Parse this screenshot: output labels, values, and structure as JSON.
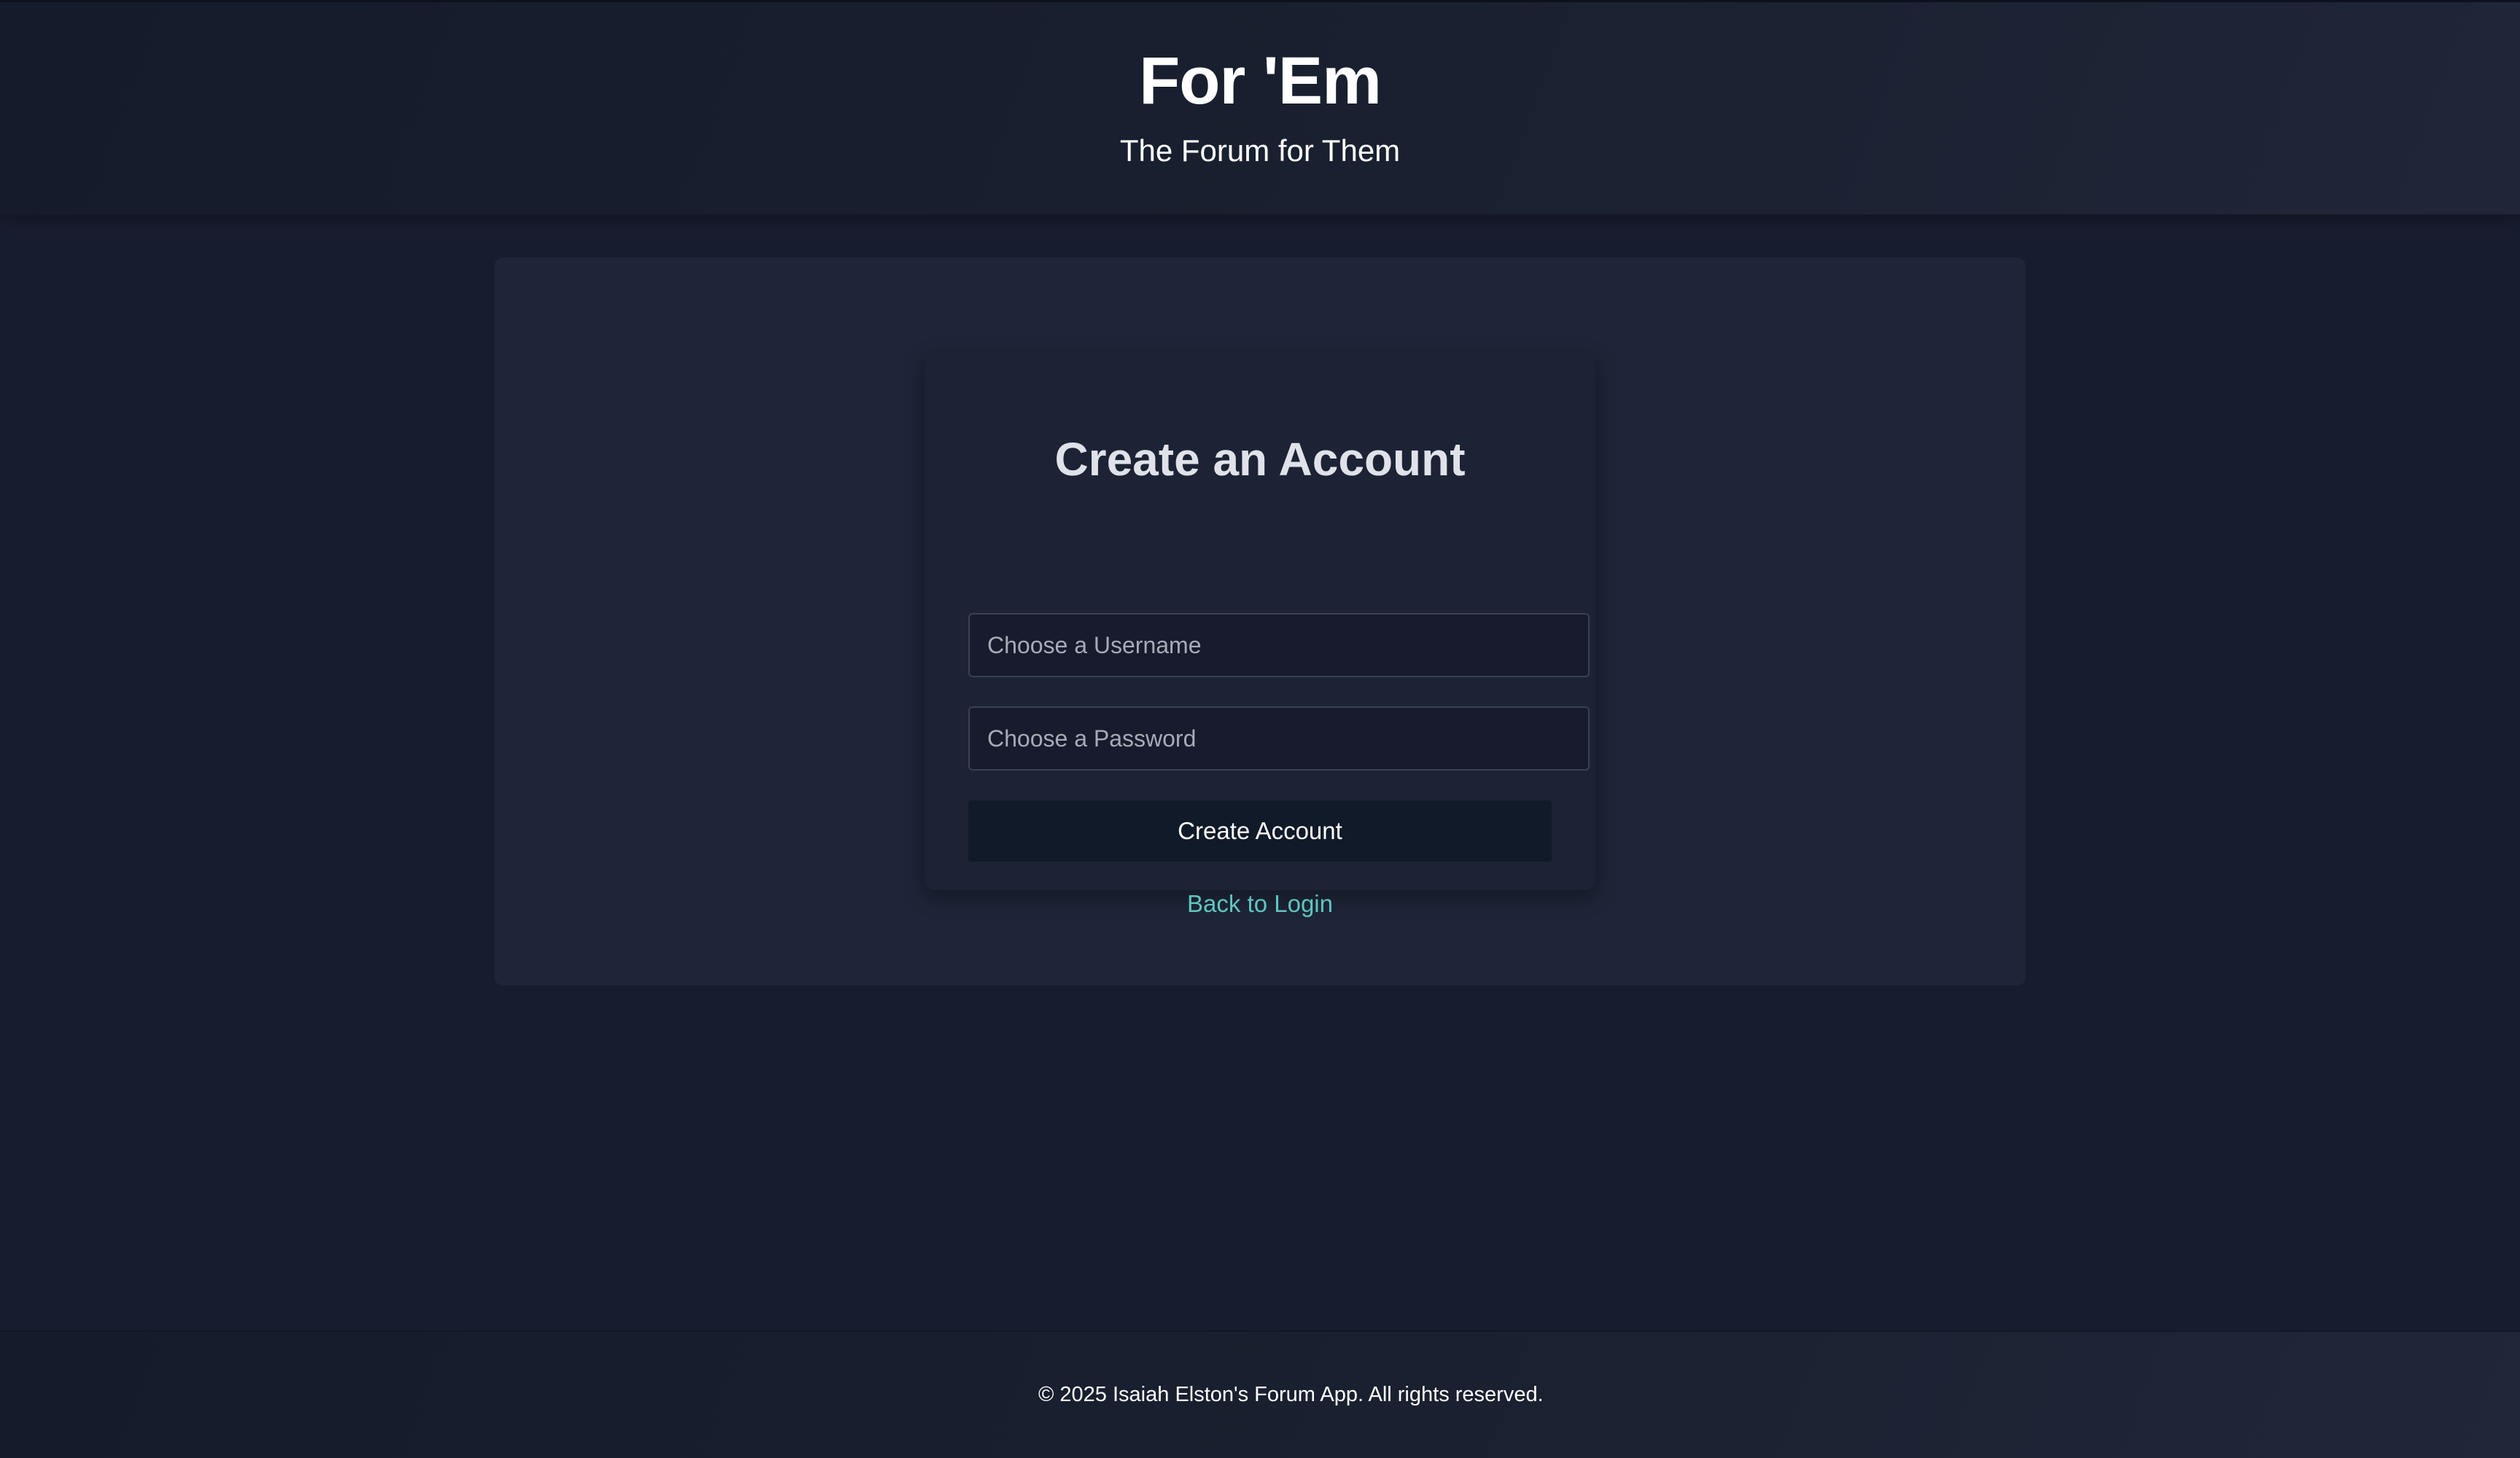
{
  "header": {
    "title": "For 'Em",
    "subtitle": "The Forum for Them"
  },
  "signup": {
    "title": "Create an Account",
    "username_placeholder": "Choose a Username",
    "username_value": "",
    "password_placeholder": "Choose a Password",
    "password_value": "",
    "submit_label": "Create Account",
    "back_link_label": "Back to Login"
  },
  "footer": {
    "text": "© 2025 Isaiah Elston's Forum App. All rights reserved."
  },
  "colors": {
    "page_background": "#171c2e",
    "panel_background": "#1e2538",
    "button_background": "#111a28",
    "link_accent": "#5fc6bf"
  }
}
